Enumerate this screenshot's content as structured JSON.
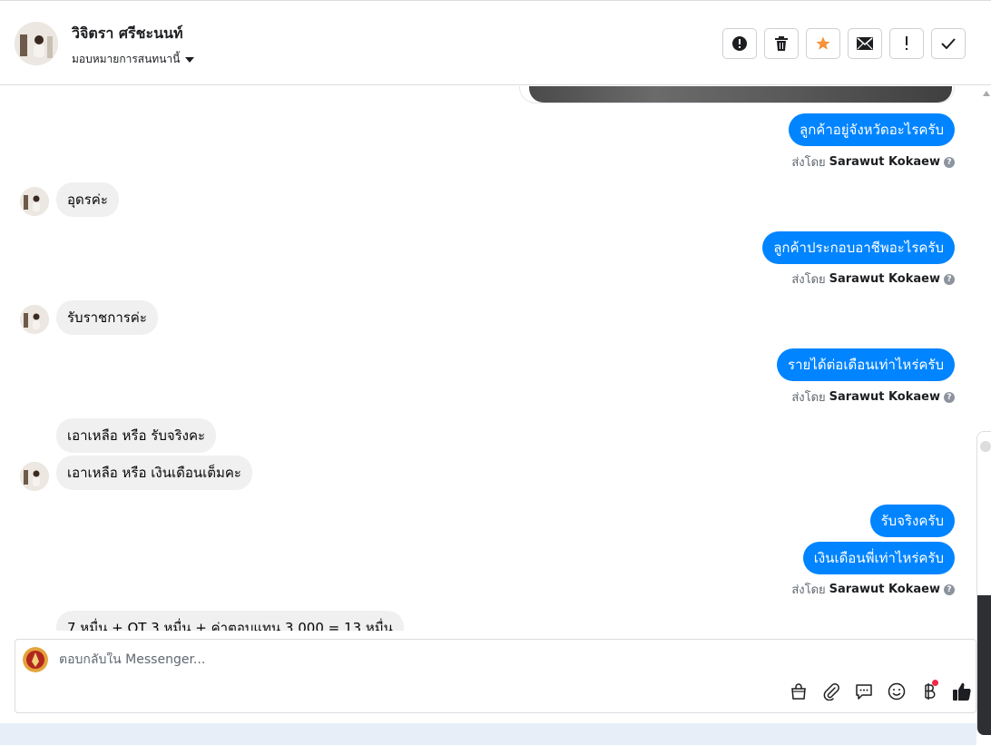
{
  "header": {
    "contact_name": "วิจิตรา ศรีชะนนท์",
    "assign_label": "มอบหมายการสนทนานี้",
    "actions": [
      {
        "name": "spam-button",
        "icon": "exclamation-circle-icon"
      },
      {
        "name": "delete-button",
        "icon": "trash-icon"
      },
      {
        "name": "star-button",
        "icon": "star-icon"
      },
      {
        "name": "mark-unread-button",
        "icon": "envelope-icon"
      },
      {
        "name": "follow-up-button",
        "icon": "exclamation-icon"
      },
      {
        "name": "mark-done-button",
        "icon": "check-icon"
      }
    ],
    "star_color": "#f7923a"
  },
  "messages": {
    "m1": "ลูกค้าอยู่จังหวัดอะไรครับ",
    "m2": "อุดรค่ะ",
    "m3": "ลูกค้าประกอบอาชีพอะไรครับ",
    "m4": "รับราชการค่ะ",
    "m5": "รายได้ต่อเดือนเท่าไหร่ครับ",
    "m6": "เอาเหลือ หรือ รับจริงคะ",
    "m7": "เอาเหลือ หรือ เงินเดือนเต็มคะ",
    "m8": "รับจริงครับ",
    "m9": "เงินเดือนพี่เท่าไหร่ครับ",
    "m10": "7 หมื่น + OT 3 หมื่น + ค่าตอบแทน 3,000 = 13 หมื่น"
  },
  "sent_by": {
    "prefix": "ส่งโดย",
    "agent": "Sarawut Kokaew"
  },
  "composer": {
    "placeholder": "ตอบกลับใน Messenger...",
    "tools": [
      "shopping-bag-icon",
      "paperclip-icon",
      "saved-reply-icon",
      "emoji-icon",
      "baht-icon",
      "thumbs-up-icon"
    ]
  },
  "colors": {
    "outgoing_bubble": "#0084ff",
    "incoming_bubble": "#f0f0f0",
    "notification_dot": "#f02849"
  }
}
